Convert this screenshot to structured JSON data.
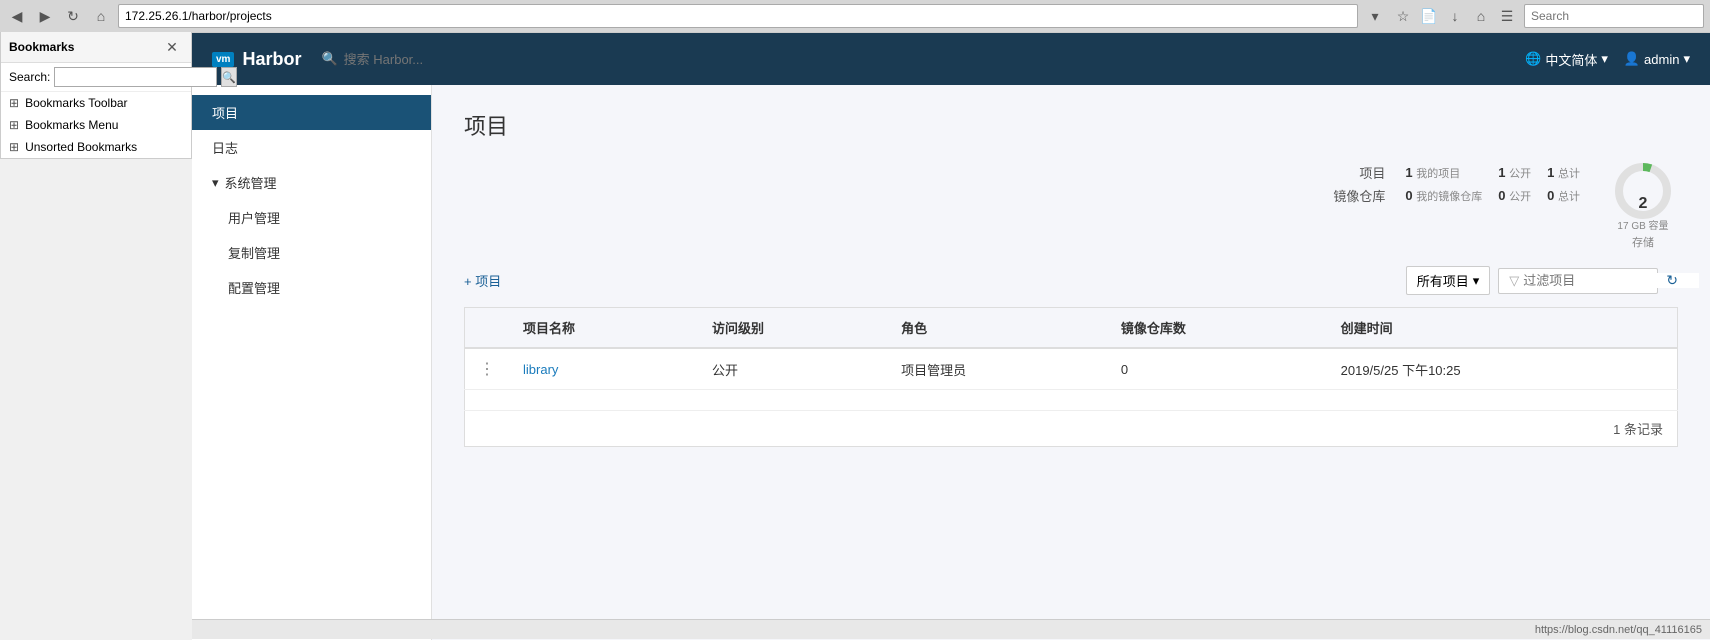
{
  "browser": {
    "url": "172.25.26.1/harbor/projects",
    "search_placeholder": "Search",
    "back_icon": "◀",
    "forward_icon": "▶",
    "refresh_icon": "↻",
    "home_icon": "⌂",
    "bookmark_icon": "★",
    "download_icon": "↓",
    "menu_icon": "☰"
  },
  "bookmarks": {
    "title": "Bookmarks",
    "close_icon": "✕",
    "search_label": "Search:",
    "search_placeholder": "",
    "search_btn": "🔍",
    "items": [
      {
        "icon": "📁",
        "label": "Bookmarks Toolbar"
      },
      {
        "icon": "📁",
        "label": "Bookmarks Menu"
      },
      {
        "icon": "📁",
        "label": "Unsorted Bookmarks"
      }
    ]
  },
  "header": {
    "logo_vm": "vm",
    "logo_text": "Harbor",
    "search_placeholder": "搜索 Harbor...",
    "lang": "中文简体",
    "lang_icon": "🌐",
    "user": "admin",
    "user_icon": "👤",
    "chevron_down": "▾"
  },
  "sidebar": {
    "items": [
      {
        "label": "项目",
        "active": true
      },
      {
        "label": "日志",
        "active": false
      }
    ],
    "group": {
      "label": "系统管理",
      "chevron": "▾",
      "sub_items": [
        "用户管理",
        "复制管理",
        "配置管理"
      ]
    }
  },
  "main": {
    "page_title": "项目",
    "stats": {
      "project_label": "项目",
      "project_mine": "1",
      "project_mine_tag": "我的项目",
      "project_public": "1",
      "project_public_tag": "公开",
      "project_total": "1",
      "project_total_tag": "总计",
      "repo_label": "镜像仓库",
      "repo_mine": "0",
      "repo_mine_tag": "我的镜像仓库",
      "repo_public": "0",
      "repo_public_tag": "公开",
      "repo_total": "0",
      "repo_total_tag": "总计"
    },
    "donut": {
      "value": "2",
      "sub_label": "17 GB 容量",
      "storage_label": "存储"
    },
    "toolbar": {
      "add_btn": "+ 项目",
      "filter_dropdown": "所有项目",
      "filter_placeholder": "过滤项目",
      "filter_icon": "▾",
      "funnel_icon": "⊿",
      "refresh_icon": "↻"
    },
    "table": {
      "columns": [
        "",
        "项目名称",
        "访问级别",
        "角色",
        "镜像仓库数",
        "创建时间"
      ],
      "rows": [
        {
          "dots": "⋮",
          "name": "library",
          "access": "公开",
          "role": "项目管理员",
          "repo_count": "0",
          "created": "2019/5/25 下午10:25"
        }
      ]
    },
    "pagination": {
      "text": "1 条记录"
    },
    "status_bar": {
      "url": "https://blog.csdn.net/qq_41116165"
    }
  }
}
